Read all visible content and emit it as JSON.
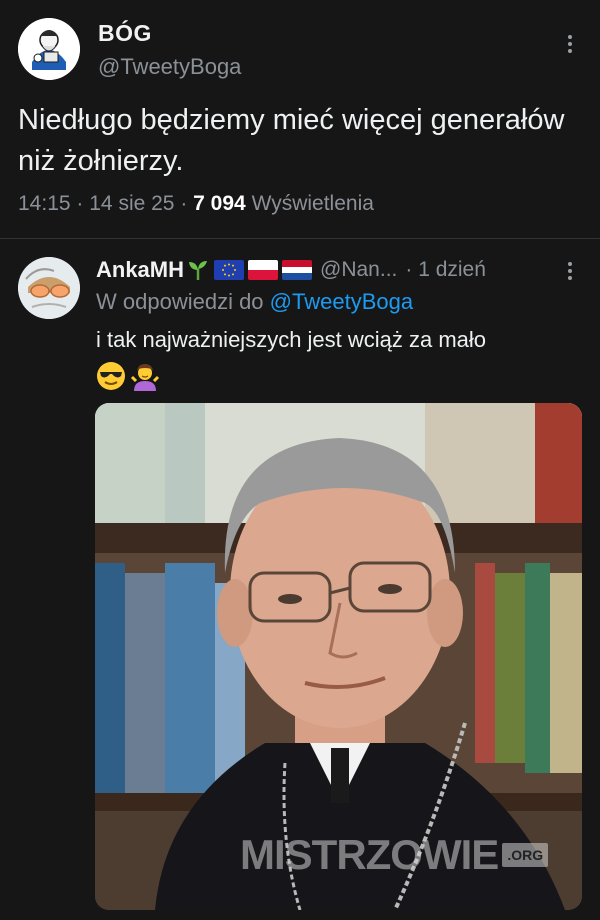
{
  "tweet": {
    "author_name": "BÓG",
    "handle": "@TweetyBoga",
    "text": "Niedługo będziemy mieć więcej generałów niż żołnierzy.",
    "time": "14:15",
    "sep1": "·",
    "date": "14 sie 25",
    "sep2": "·",
    "views_count": "7 094",
    "views_label": "Wyświetlenia"
  },
  "reply": {
    "author_name": "AnkaMH",
    "handle": "@Nan...",
    "time_ago": "· 1 dzień",
    "in_reply_prefix": "W odpowiedzi do",
    "in_reply_handle": "@TweetyBoga",
    "text": "i tak najważniejszych jest wciąż za mało",
    "emojis": [
      "smiling-face-with-sunglasses-emoji",
      "person-shrugging-emoji"
    ],
    "flags": [
      "eu-flag",
      "poland-flag",
      "netherlands-flag"
    ]
  },
  "watermark": {
    "text": "MISTRZOWIE",
    "suffix": ".ORG"
  },
  "colors": {
    "background": "#161616",
    "link": "#1d9bf0",
    "muted": "#8b9197"
  }
}
